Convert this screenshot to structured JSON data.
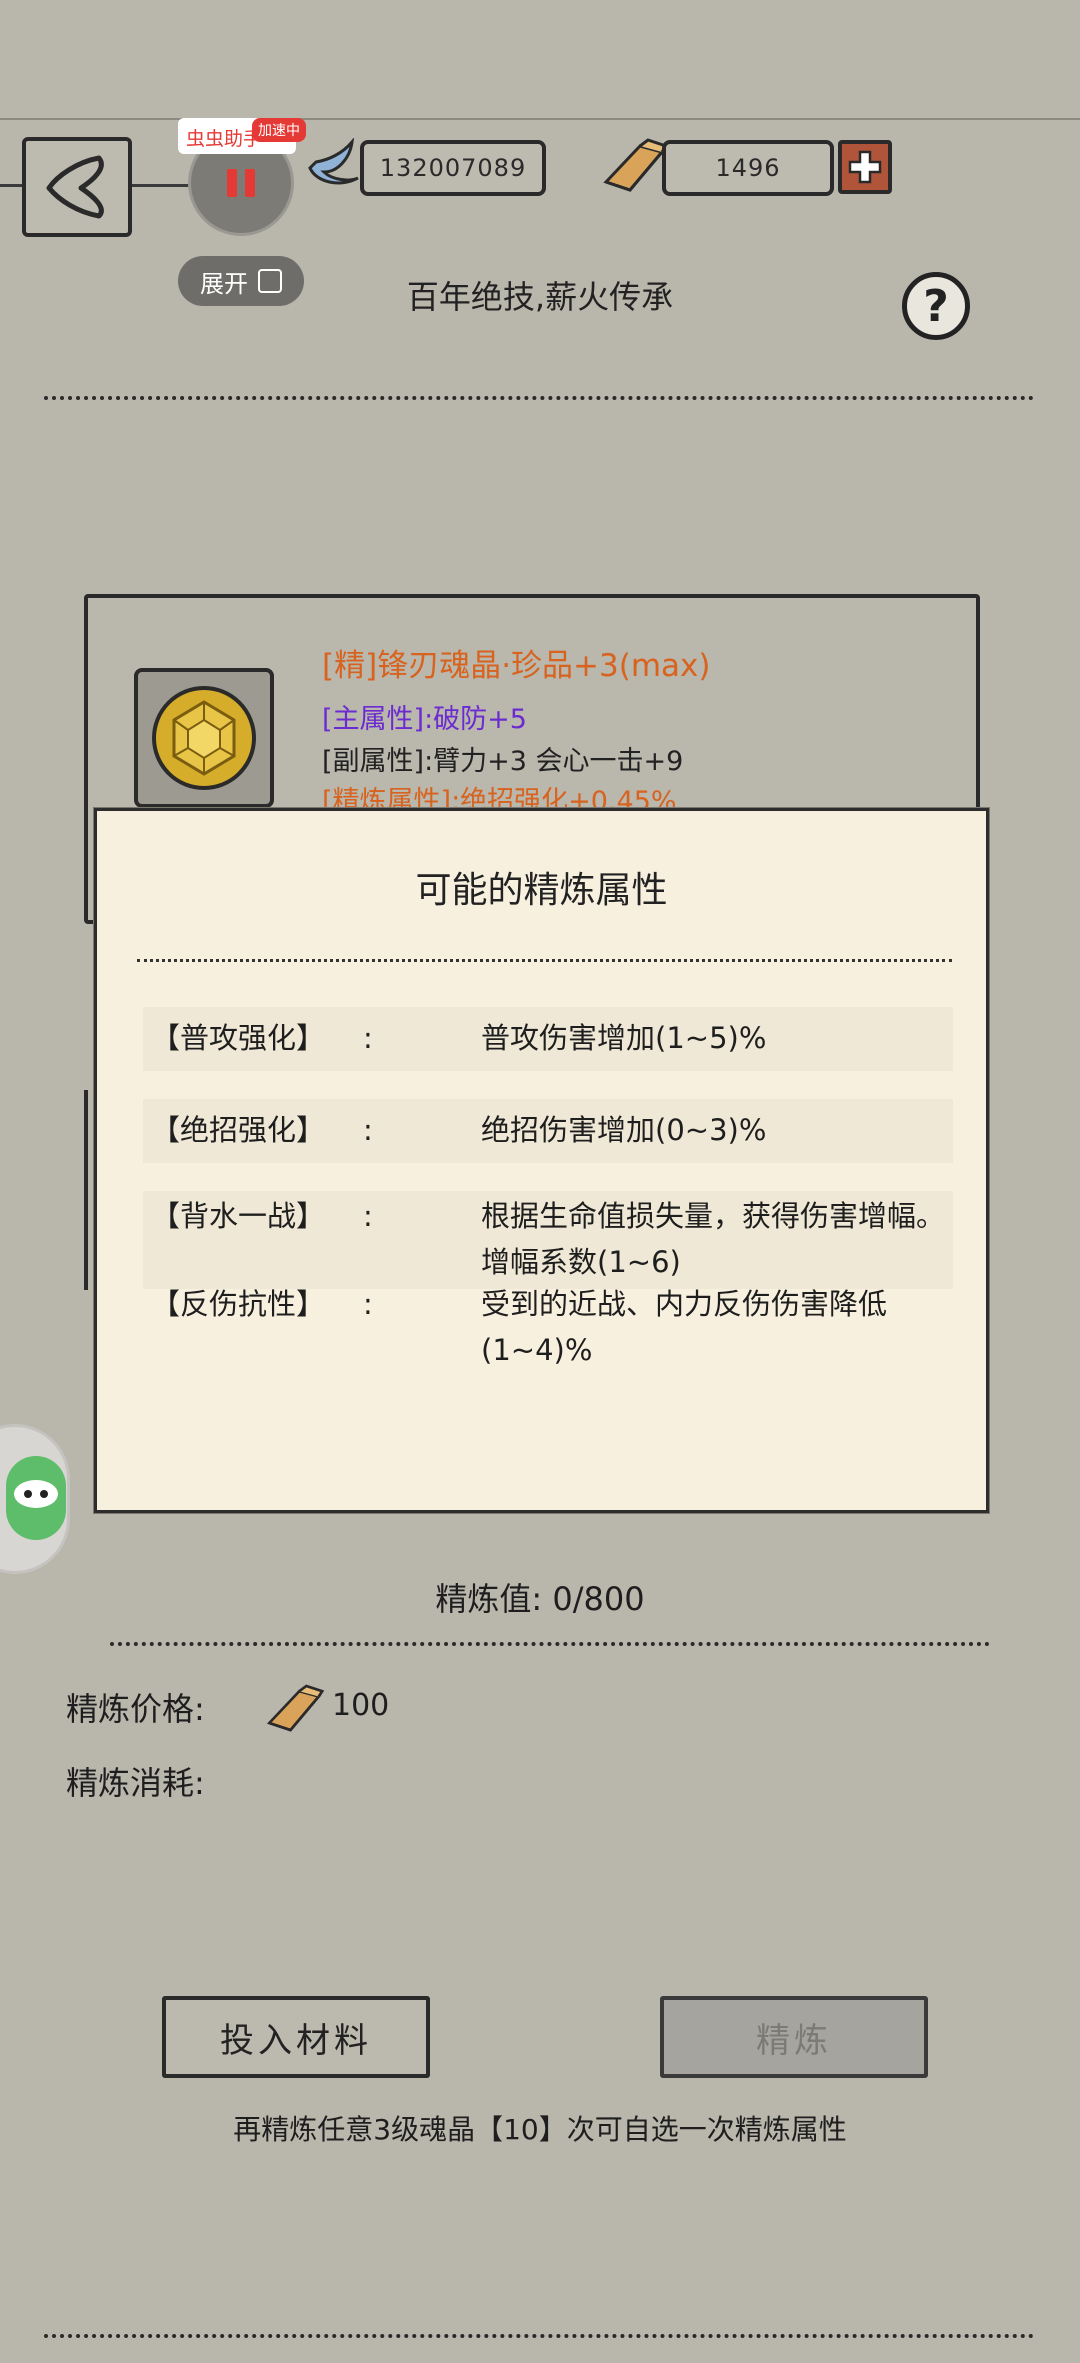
{
  "header": {
    "silver_amount": "132007089",
    "gold_amount": "1496",
    "title": "百年绝技,薪火传承",
    "help_symbol": "?"
  },
  "helper_overlay": {
    "label": "虫虫助手",
    "badge": "加速中",
    "expand_label": "展开"
  },
  "item_card": {
    "name": "[精]锋刃魂晶·珍品+3(max)",
    "main_attr": "[主属性]:破防+5",
    "sub_attr": "[副属性]:臂力+3 会心一击+9",
    "refine_attr": "[精炼属性]:绝招强化+0.45%",
    "colors": {
      "name": "#d8631f",
      "main": "#6b2bd0",
      "sub": "#222222",
      "refine": "#d8631f"
    }
  },
  "popup": {
    "title": "可能的精炼属性",
    "rows": [
      {
        "key": "【普攻强化】",
        "colon": ":",
        "value": "普攻伤害增加(1~5)%"
      },
      {
        "key": "【绝招强化】",
        "colon": ":",
        "value": "绝招伤害增加(0~3)%"
      },
      {
        "key": "【背水一战】",
        "colon": ":",
        "value": "根据生命值损失量，获得伤害增幅。增幅系数(1~6)"
      },
      {
        "key": "【反伤抗性】",
        "colon": ":",
        "value": "受到的近战、内力反伤伤害降低(1~4)%"
      }
    ]
  },
  "refine": {
    "value_label": "精炼值: 0/800",
    "price_label": "精炼价格:",
    "price_amount": "100",
    "consume_label": "精炼消耗:"
  },
  "buttons": {
    "materials": "投入材料",
    "refine": "精炼"
  },
  "hint": "再精炼任意3级魂晶【10】次可自选一次精炼属性"
}
